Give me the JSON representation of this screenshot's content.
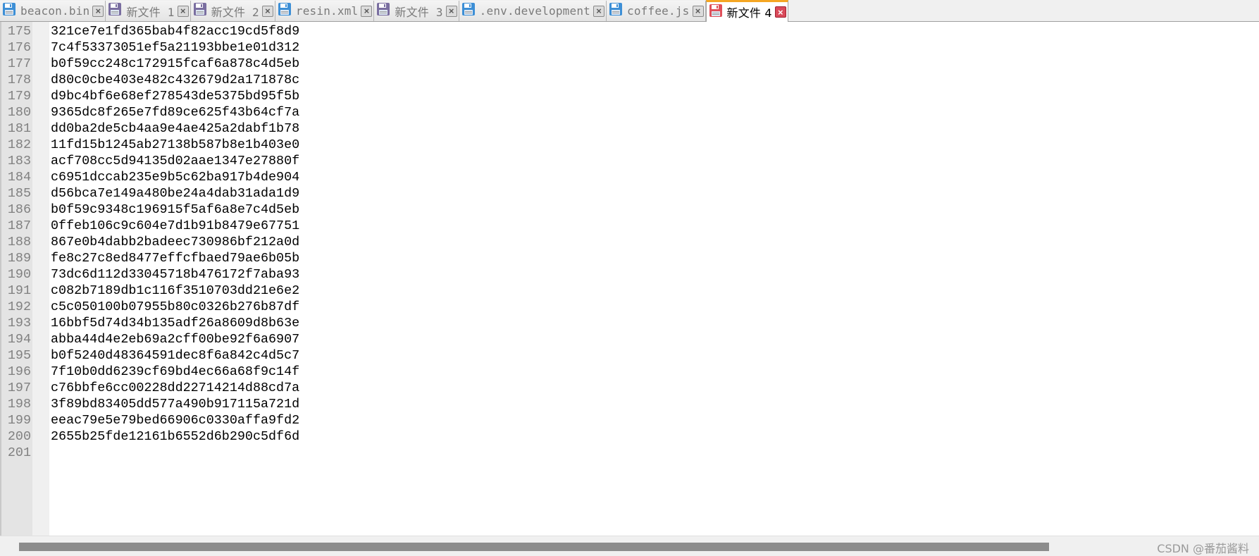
{
  "tabs": [
    {
      "label": "beacon.bin",
      "icon": "disk-icon-saved",
      "active": false
    },
    {
      "label": "新文件 1",
      "icon": "disk-icon-unsaved",
      "active": false
    },
    {
      "label": "新文件 2",
      "icon": "disk-icon-unsaved",
      "active": false
    },
    {
      "label": "resin.xml",
      "icon": "disk-icon-saved",
      "active": false
    },
    {
      "label": "新文件 3",
      "icon": "disk-icon-unsaved",
      "active": false
    },
    {
      "label": ".env.development",
      "icon": "disk-icon-saved",
      "active": false
    },
    {
      "label": "coffee.js",
      "icon": "disk-icon-saved",
      "active": false
    },
    {
      "label": "新文件 4",
      "icon": "disk-icon-modified",
      "active": true
    }
  ],
  "colors": {
    "disk_saved": "#3d8fd6",
    "disk_unsaved": "#7a6ea0",
    "disk_modified": "#e0505a",
    "active_tab_accent": "#f5a623",
    "gutter_bg": "#e4e4e4",
    "line_number": "#808080"
  },
  "editor": {
    "lines": [
      {
        "num": "175",
        "text": "321ce7e1fd365bab4f82acc19cd5f8d9"
      },
      {
        "num": "176",
        "text": "7c4f53373051ef5a21193bbe1e01d312"
      },
      {
        "num": "177",
        "text": "b0f59cc248c172915fcaf6a878c4d5eb"
      },
      {
        "num": "178",
        "text": "d80c0cbe403e482c432679d2a171878c"
      },
      {
        "num": "179",
        "text": "d9bc4bf6e68ef278543de5375bd95f5b"
      },
      {
        "num": "180",
        "text": "9365dc8f265e7fd89ce625f43b64cf7a"
      },
      {
        "num": "181",
        "text": "dd0ba2de5cb4aa9e4ae425a2dabf1b78"
      },
      {
        "num": "182",
        "text": "11fd15b1245ab27138b587b8e1b403e0"
      },
      {
        "num": "183",
        "text": "acf708cc5d94135d02aae1347e27880f"
      },
      {
        "num": "184",
        "text": "c6951dccab235e9b5c62ba917b4de904"
      },
      {
        "num": "185",
        "text": "d56bca7e149a480be24a4dab31ada1d9"
      },
      {
        "num": "186",
        "text": "b0f59c9348c196915f5af6a8e7c4d5eb"
      },
      {
        "num": "187",
        "text": "0ffeb106c9c604e7d1b91b8479e67751"
      },
      {
        "num": "188",
        "text": "867e0b4dabb2badeec730986bf212a0d"
      },
      {
        "num": "189",
        "text": "fe8c27c8ed8477effcfbaed79ae6b05b"
      },
      {
        "num": "190",
        "text": "73dc6d112d33045718b476172f7aba93"
      },
      {
        "num": "191",
        "text": "c082b7189db1c116f3510703dd21e6e2"
      },
      {
        "num": "192",
        "text": "c5c050100b07955b80c0326b276b87df"
      },
      {
        "num": "193",
        "text": "16bbf5d74d34b135adf26a8609d8b63e"
      },
      {
        "num": "194",
        "text": "abba44d4e2eb69a2cff00be92f6a6907"
      },
      {
        "num": "195",
        "text": "b0f5240d48364591dec8f6a842c4d5c7"
      },
      {
        "num": "196",
        "text": "7f10b0dd6239cf69bd4ec66a68f9c14f"
      },
      {
        "num": "197",
        "text": "c76bbfe6cc00228dd22714214d88cd7a"
      },
      {
        "num": "198",
        "text": "3f89bd83405dd577a490b917115a721d"
      },
      {
        "num": "199",
        "text": "eeac79e5e79bed66906c0330affa9fd2"
      },
      {
        "num": "200",
        "text": "2655b25fde12161b6552d6b290c5df6d"
      },
      {
        "num": "201",
        "text": ""
      }
    ]
  },
  "watermark": "CSDN @番茄酱料"
}
